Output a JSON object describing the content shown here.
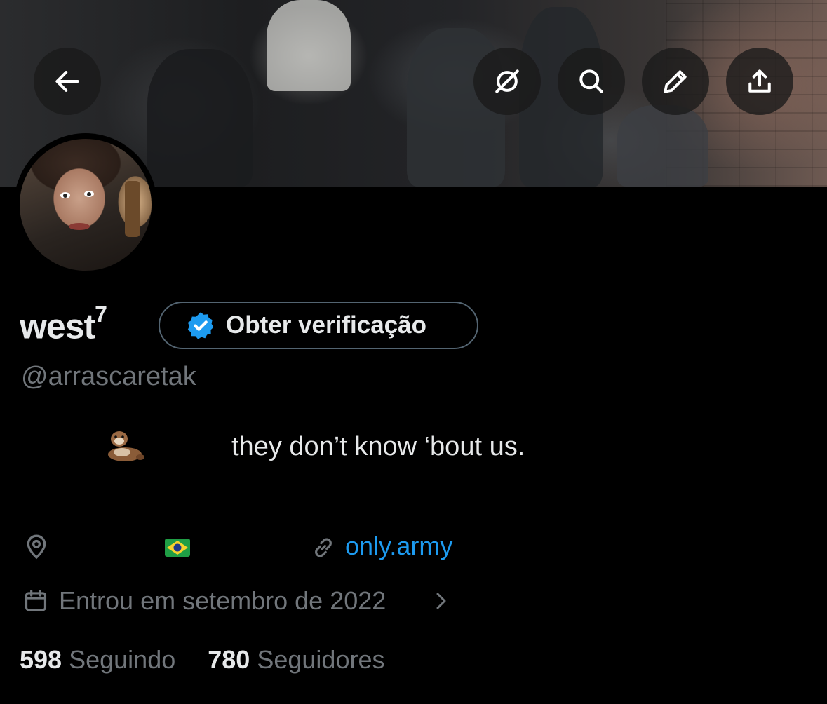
{
  "header": {
    "buttons": [
      {
        "name": "back-button",
        "icon": "arrow-left-icon"
      },
      {
        "name": "grok-button",
        "icon": "slashed-circle-icon"
      },
      {
        "name": "search-button",
        "icon": "search-icon"
      },
      {
        "name": "edit-button",
        "icon": "pencil-icon"
      },
      {
        "name": "share-button",
        "icon": "share-icon"
      }
    ]
  },
  "profile": {
    "display_name": "west",
    "display_name_superscript": "7",
    "verify_label": "Obter verificação",
    "handle": "@arrascaretak",
    "bio_emoji": "otter-emoji",
    "bio_text": "they don’t know ‘bout us.",
    "location_flag": "brazil-flag",
    "link": "only.army",
    "joined": "Entrou em setembro de 2022",
    "following_count": "598",
    "following_label": "Seguindo",
    "followers_count": "780",
    "followers_label": "Seguidores"
  },
  "colors": {
    "background": "#000000",
    "text_primary": "#e7e9ea",
    "text_secondary": "#71767b",
    "link": "#1d9bf0",
    "verified_badge": "#1d9bf0"
  }
}
